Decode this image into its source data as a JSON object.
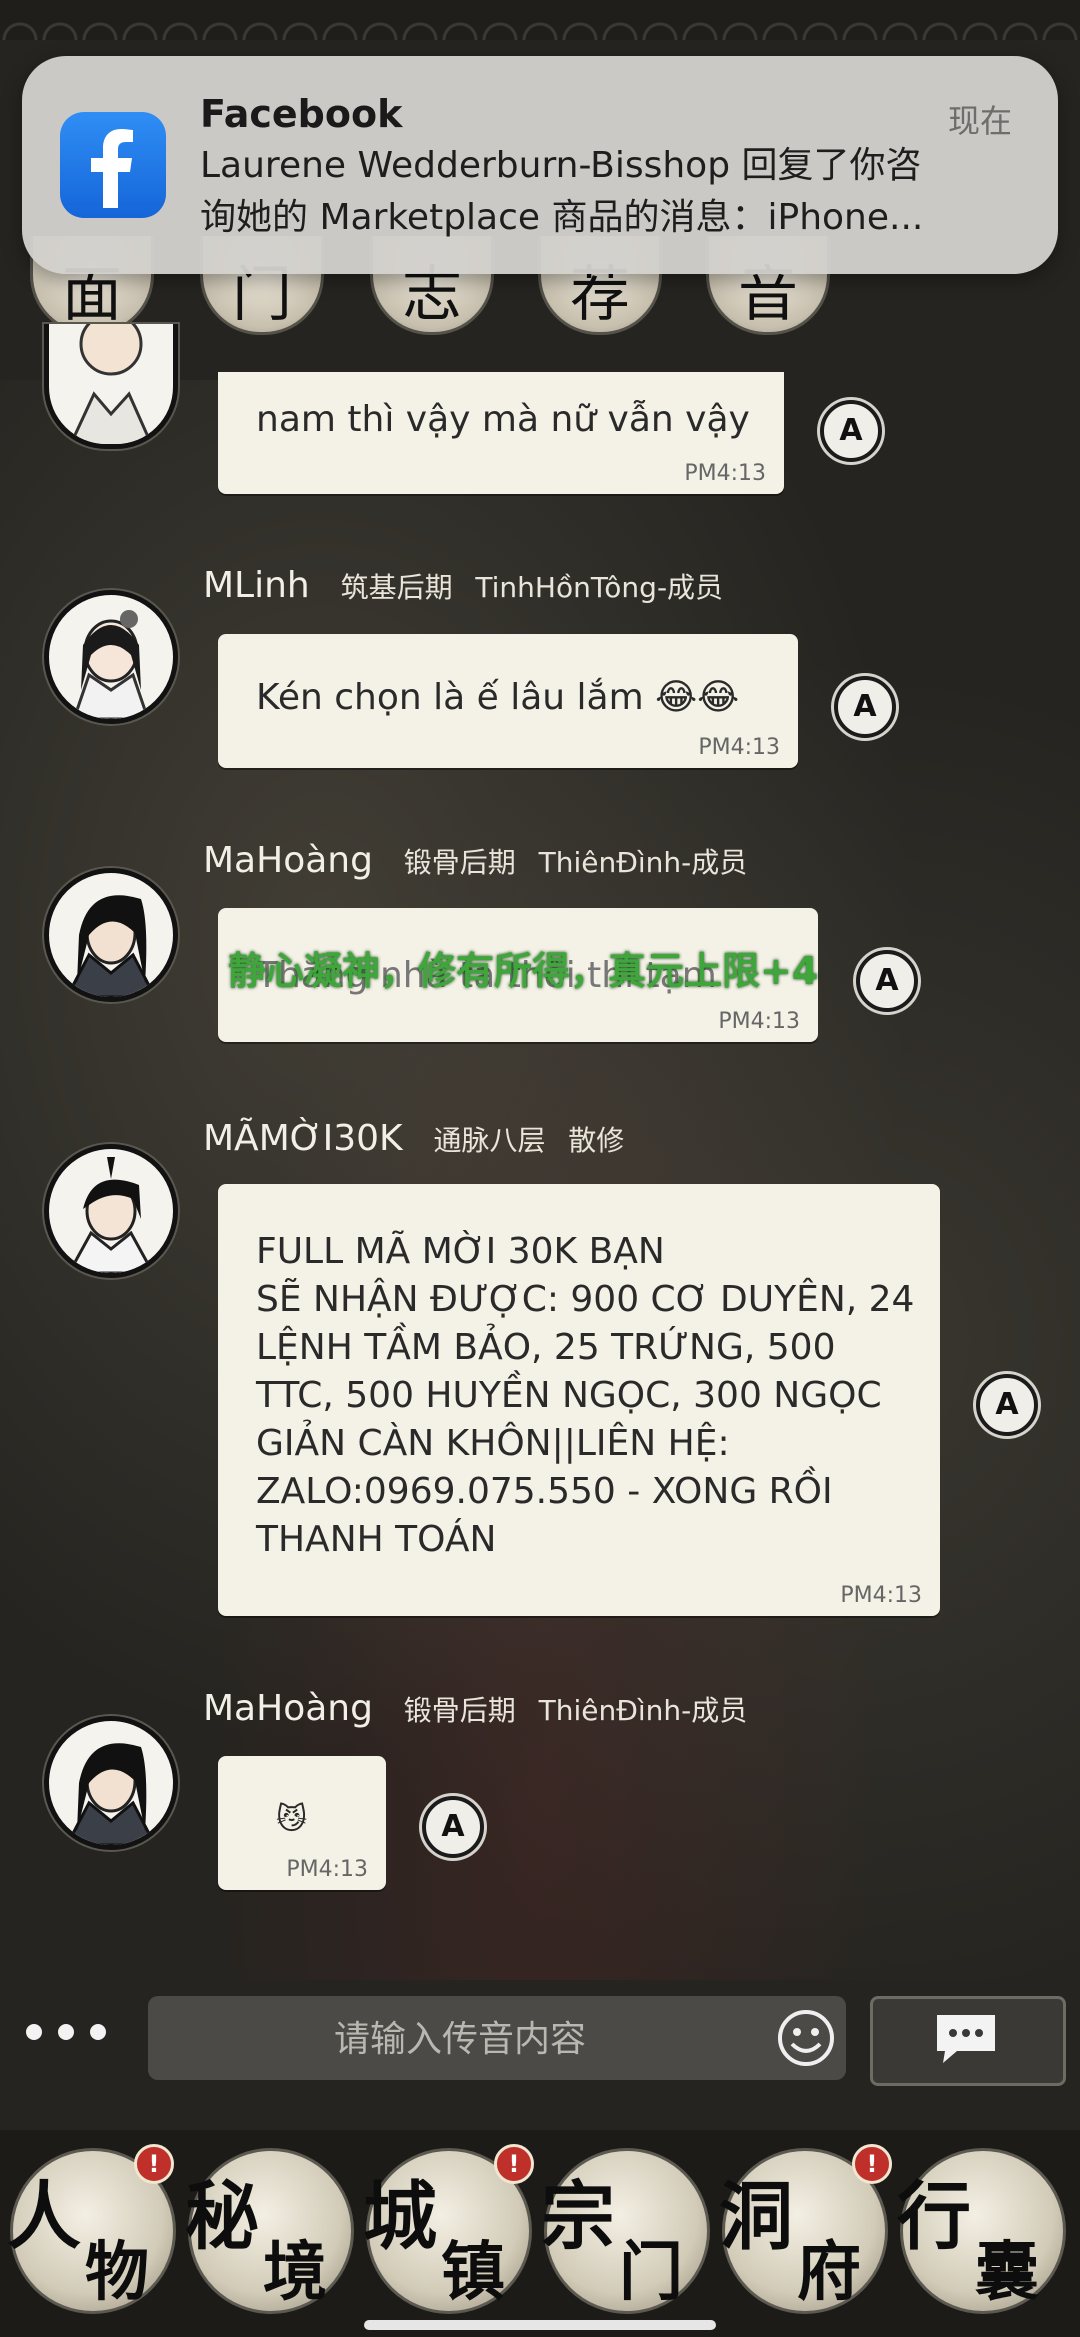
{
  "notification": {
    "app": "Facebook",
    "time": "现在",
    "line1": "Laurene Wedderburn-Bisshop 回复了你咨",
    "line2": "询她的 Marketplace 商品的消息：iPhone..."
  },
  "top_buttons": [
    "面",
    "门",
    "志",
    "荐",
    "音"
  ],
  "messages": [
    {
      "name": "",
      "realm": "",
      "sect": "",
      "text": "nam thì vậy mà nữ vẫn vậy",
      "time": "PM4:13"
    },
    {
      "name": "MLinh",
      "realm": "筑基后期",
      "sect": "TinhHồnTông-成员",
      "text": "Kén chọn là ế lâu lắm 😂😂",
      "time": "PM4:13"
    },
    {
      "name": "MaHoàng",
      "realm": "锻骨后期",
      "sect": "ThiênĐình-成员",
      "text": "Thằng nhà ta thôi thì tạm",
      "time": "PM4:13"
    },
    {
      "name": "MÃMỜI30K",
      "realm": "通脉八层",
      "sect": "散修",
      "text": "FULL MÃ MỜI 30K                BẠN\nSẼ NHẬN ĐƯỢC: 900 CƠ DUYÊN, 24\nLỆNH TẦM BẢO, 25 TRỨNG, 500\nTTC, 500 HUYỀN NGỌC, 300 NGỌC\nGIẢN CÀN KHÔN||LIÊN HỆ:\nZALO:0969.075.550 - XONG RỒI\nTHANH TOÁN",
      "time": "PM4:13"
    },
    {
      "name": "MaHoàng",
      "realm": "锻骨后期",
      "sect": "ThiênĐình-成员",
      "text": "😼",
      "time": "PM4:13"
    }
  ],
  "cultivation_toast": "静心凝神，修有所得，真元上限+4",
  "a_button_label": "A",
  "input": {
    "placeholder": "请输入传音内容"
  },
  "bottom_nav": [
    {
      "c1": "人",
      "c2": "物",
      "badge": "!"
    },
    {
      "c1": "秘",
      "c2": "境",
      "badge": ""
    },
    {
      "c1": "城",
      "c2": "镇",
      "badge": "!"
    },
    {
      "c1": "宗",
      "c2": "门",
      "badge": ""
    },
    {
      "c1": "洞",
      "c2": "府",
      "badge": "!"
    },
    {
      "c1": "行",
      "c2": "囊",
      "badge": ""
    }
  ],
  "colors": {
    "bubble": "#f4f1e6",
    "toast": "#3ea63b",
    "badge": "#c0302a",
    "fb": "#1877f2"
  }
}
